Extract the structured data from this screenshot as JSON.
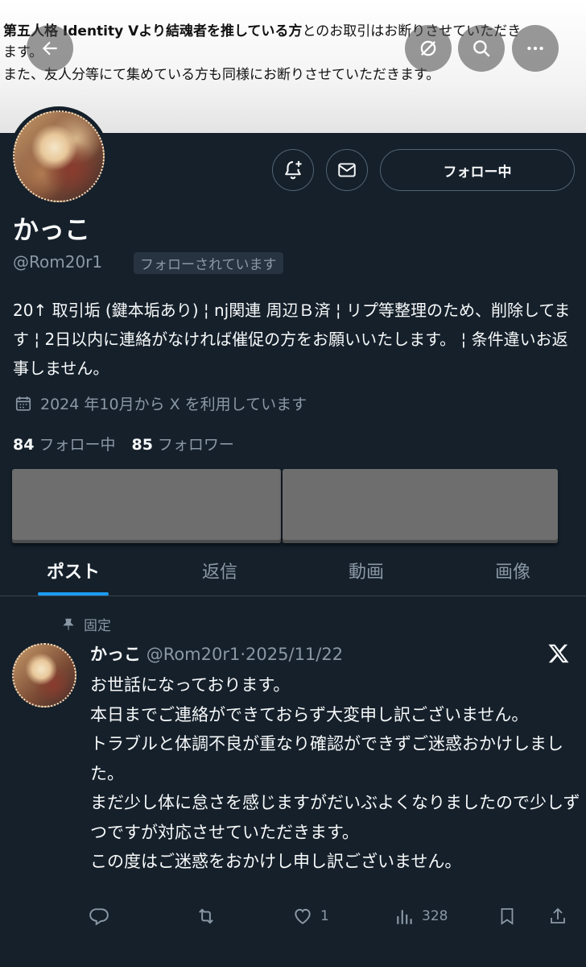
{
  "banner": {
    "bold_text": "第五人格 Identity Vより結魂者を推している方",
    "line1_rest": "とのお取引はお断りさせていただき",
    "line1_wrap": "ます。",
    "line2": "また、友人分等にて集めている方も同様にお断りさせていただきます。"
  },
  "header_icons": [
    "back-arrow-icon",
    "mute-icon",
    "search-icon",
    "more-icon"
  ],
  "profile": {
    "name": "かっこ",
    "handle": "@Rom20r1",
    "follows_you": "フォローされています",
    "follow_button": "フォロー中",
    "bio": "20↑ 取引垢 (鍵本垢あり) ¦ nj関連 周辺Ｂ済 ¦ リプ等整理のため、削除してます ¦ 2日以内に連絡がなければ催促の方をお願いいたします。 ¦ 条件違いお返事しません。",
    "joined": "2024 年10月から X を利用しています",
    "following_count": "84",
    "following_label": "フォロー中",
    "followers_count": "85",
    "followers_label": "フォロワー"
  },
  "tabs": [
    {
      "label": "ポスト",
      "active": true
    },
    {
      "label": "返信",
      "active": false
    },
    {
      "label": "動画",
      "active": false
    },
    {
      "label": "画像",
      "active": false
    }
  ],
  "post": {
    "pinned_label": "固定",
    "author": "かっこ",
    "handle": "@Rom20r1",
    "separator": "·",
    "date": "2025/11/22",
    "body": "お世話になっております。\n本日までご連絡ができておらず大変申し訳ございません。\nトラブルと体調不良が重なり確認ができずご迷惑おかけしました。\nまだ少し体に怠さを感じますがだいぶよくなりましたので少しずつですが対応させていただきます。\nこの度はご迷惑をおかけし申し訳ございません。",
    "likes": "1",
    "views": "328"
  },
  "colors": {
    "background": "#15202b",
    "accent": "#1d9bf0",
    "muted": "#8b98a5"
  }
}
